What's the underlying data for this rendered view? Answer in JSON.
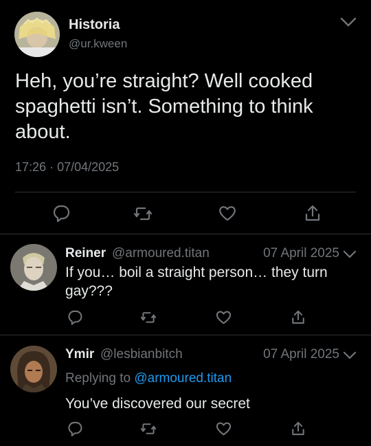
{
  "main_tweet": {
    "display_name": "Historia",
    "handle": "@ur.kween",
    "text": "Heh, you’re straight? Well cooked spaghetti isn’t. Something to think about.",
    "time": "17:26",
    "separator": "·",
    "date": "07/04/2025"
  },
  "replies": [
    {
      "display_name": "Reiner",
      "handle": "@armoured.titan",
      "date": "07 April 2025",
      "text": "If you… boil a straight person… they turn gay???"
    },
    {
      "display_name": "Ymir",
      "handle": "@lesbianbitch",
      "date": "07 April 2025",
      "replying_prefix": "Replying to",
      "replying_to": "@armoured.titan",
      "text": "You’ve discovered our secret"
    }
  ],
  "icons": {
    "reply": "reply-icon",
    "retweet": "retweet-icon",
    "like": "heart-icon",
    "share": "share-icon",
    "menu": "chevron-down-icon"
  },
  "colors": {
    "background": "#000000",
    "text": "#e7e9ea",
    "muted": "#71767b",
    "link": "#1d9bf0",
    "divider": "#2f3336"
  }
}
